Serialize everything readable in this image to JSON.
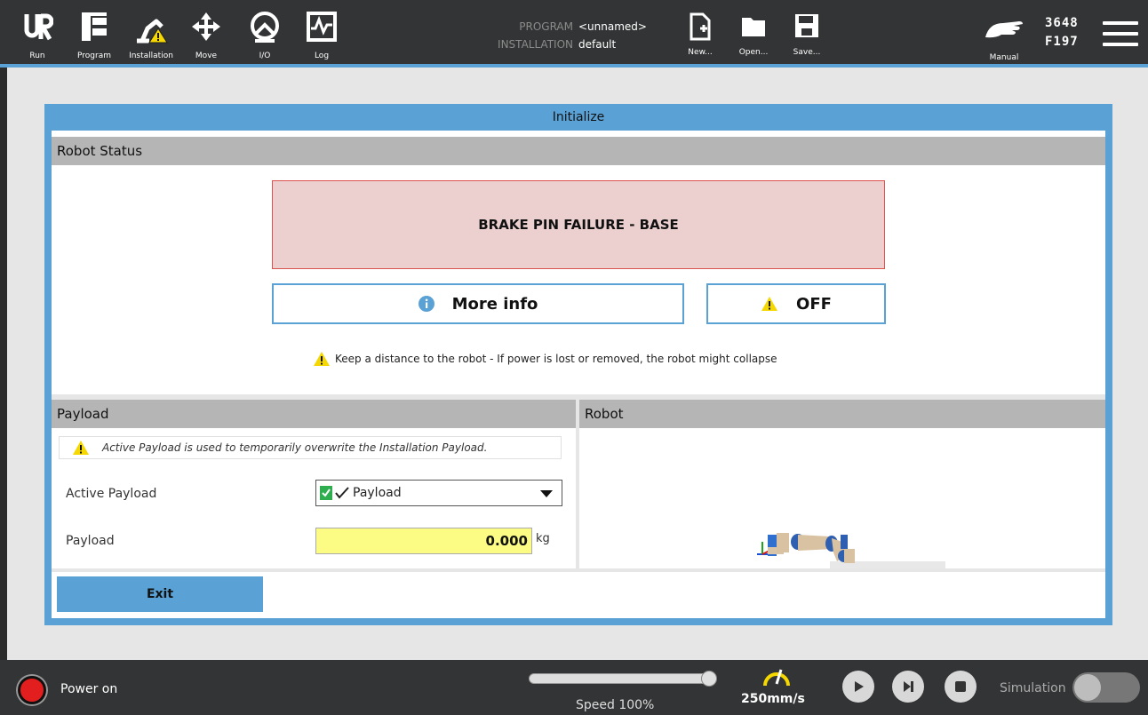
{
  "topbar": {
    "nav": [
      {
        "label": "Run",
        "icon": "ur-logo-icon"
      },
      {
        "label": "Program",
        "icon": "program-icon"
      },
      {
        "label": "Installation",
        "icon": "installation-warning-icon"
      },
      {
        "label": "Move",
        "icon": "move-arrows-icon"
      },
      {
        "label": "I/O",
        "icon": "io-icon"
      },
      {
        "label": "Log",
        "icon": "log-icon"
      }
    ],
    "program_key": "PROGRAM",
    "program_value": "<unnamed>",
    "installation_key": "INSTALLATION",
    "installation_value": "default",
    "file_buttons": [
      {
        "label": "New...",
        "icon": "new-file-icon"
      },
      {
        "label": "Open...",
        "icon": "open-folder-icon"
      },
      {
        "label": "Save...",
        "icon": "save-icon"
      }
    ],
    "mode_label": "Manual",
    "serial_line1": "3648",
    "serial_line2": "F197"
  },
  "dialog": {
    "title": "Initialize",
    "robot_status_header": "Robot Status",
    "error_message": "BRAKE PIN FAILURE - BASE",
    "more_info_label": "More info",
    "off_label": "OFF",
    "warning_text": "Keep a distance to the robot - If power is lost or removed, the robot might collapse",
    "payload_header": "Payload",
    "robot_header": "Robot",
    "payload_note": "Active Payload is used to temporarily overwrite the Installation Payload.",
    "active_payload_label": "Active Payload",
    "active_payload_value": "Payload",
    "payload_label": "Payload",
    "payload_value": "0.000",
    "payload_unit": "kg",
    "exit_label": "Exit"
  },
  "bottombar": {
    "power_label": "Power on",
    "speed_label": "Speed 100%",
    "speed_fraction": 1.0,
    "tcp_speed": "250mm/s",
    "simulation_label": "Simulation",
    "simulation_on": false
  },
  "colors": {
    "accent_blue": "#5aa2d6",
    "error_bg": "#ecd0d0",
    "error_border": "#d9534f",
    "warning_yellow": "#f5d800",
    "input_yellow": "#fcfc85",
    "power_red": "#e31e1e",
    "bar_dark": "#333435"
  }
}
